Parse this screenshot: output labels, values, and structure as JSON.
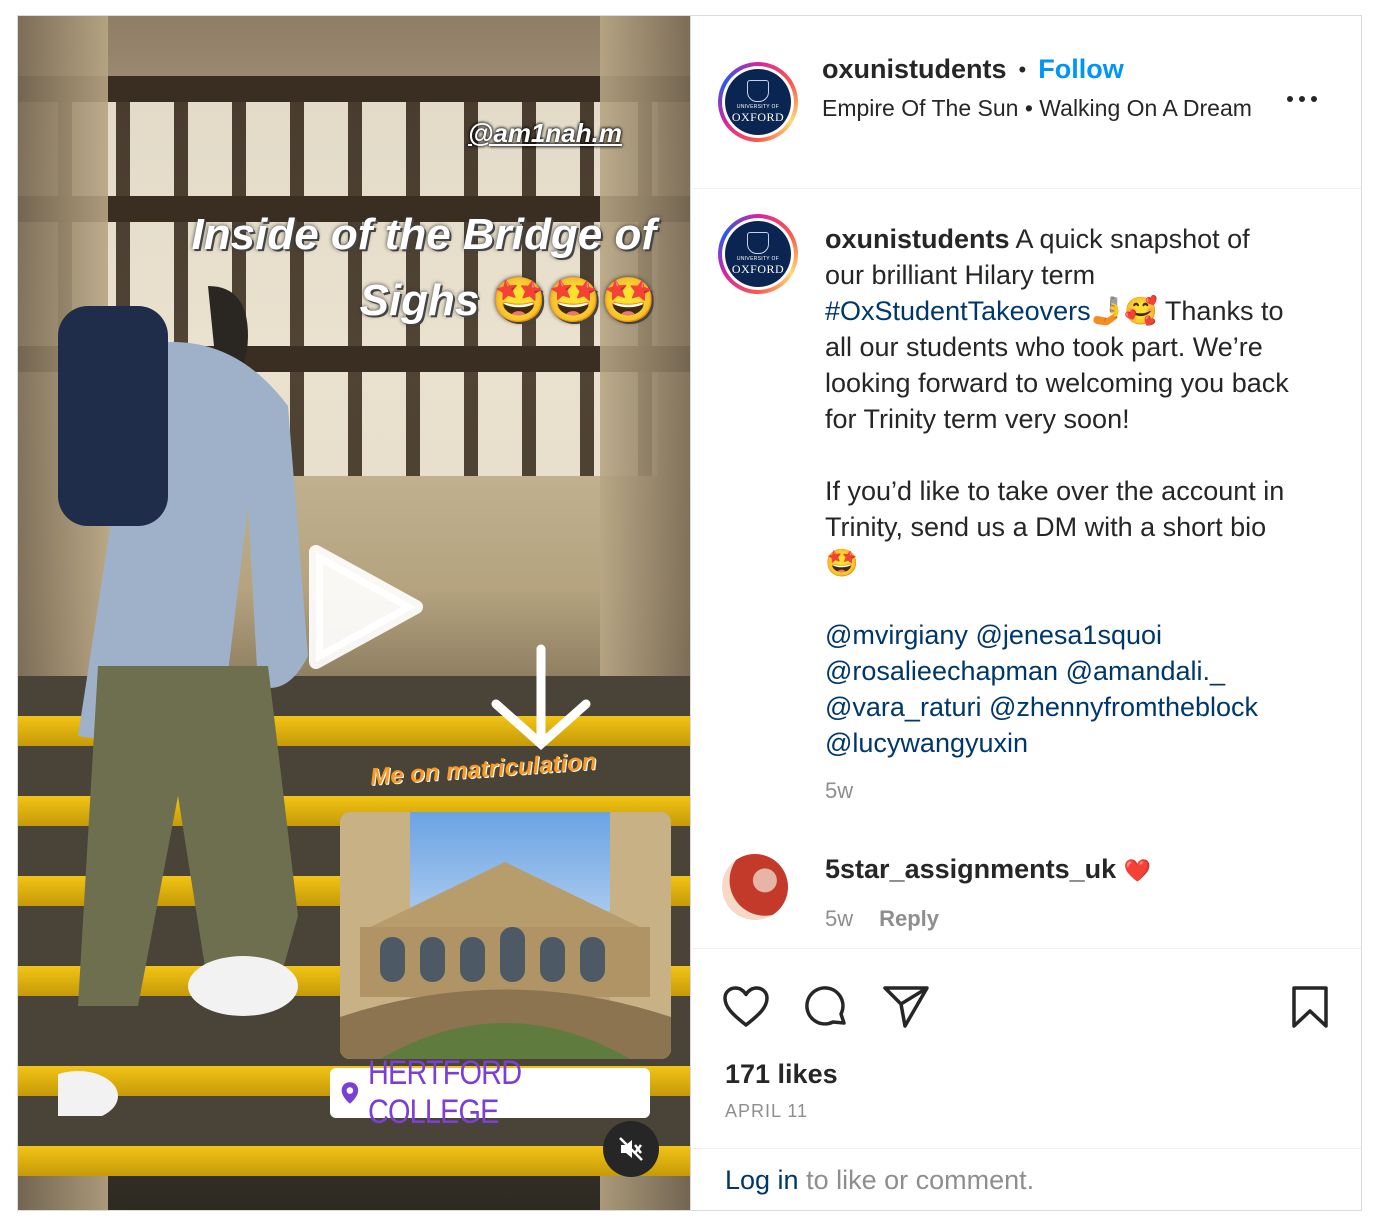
{
  "media": {
    "story_handle": "@am1nah.m",
    "story_title_line1": "Inside of the Bridge of",
    "story_title_line2": "Sighs",
    "story_title_emoji": "🤩🤩🤩",
    "matric_text": "Me on matriculation",
    "location_tag": "HERTFORD COLLEGE",
    "icons": [
      "play-icon",
      "mute-icon",
      "location-pin-icon",
      "arrow-down-icon"
    ]
  },
  "header": {
    "username": "oxunistudents",
    "separator": "•",
    "follow_label": "Follow",
    "music_artist": "Empire Of The Sun",
    "music_separator": "•",
    "music_title": "Walking On A Dream",
    "avatar_university": "UNIVERSITY OF",
    "avatar_name": "OXFORD"
  },
  "caption": {
    "username": "oxunistudents",
    "text_1": "A quick snapshot of our brilliant Hilary term",
    "hashtag": "#OxStudentTakeovers",
    "text_2_emoji": "🤳🥰",
    "text_3": "Thanks to all our students who took part. We’re looking forward to welcoming you back for Trinity term very soon!",
    "text_4": "If you’d like to take over the account in Trinity, send us a DM with a short bio",
    "text_4_emoji": "🤩",
    "mentions": [
      "@mvirgiany",
      "@jenesa1squoi",
      "@rosalieechapman",
      "@amandali._",
      "@vara_raturi",
      "@zhennyfromtheblock",
      "@lucywangyuxin"
    ],
    "time": "5w"
  },
  "comment": {
    "username": "5star_assignments_uk",
    "text": "❤️",
    "time": "5w",
    "reply_label": "Reply"
  },
  "actions": {
    "likes": "171 likes",
    "date": "APRIL 11",
    "login_link": "Log in",
    "login_text": " to like or comment."
  },
  "colors": {
    "follow": "#0095f6",
    "link": "#00376b",
    "muted": "#8e8e8e",
    "text": "#262626"
  }
}
